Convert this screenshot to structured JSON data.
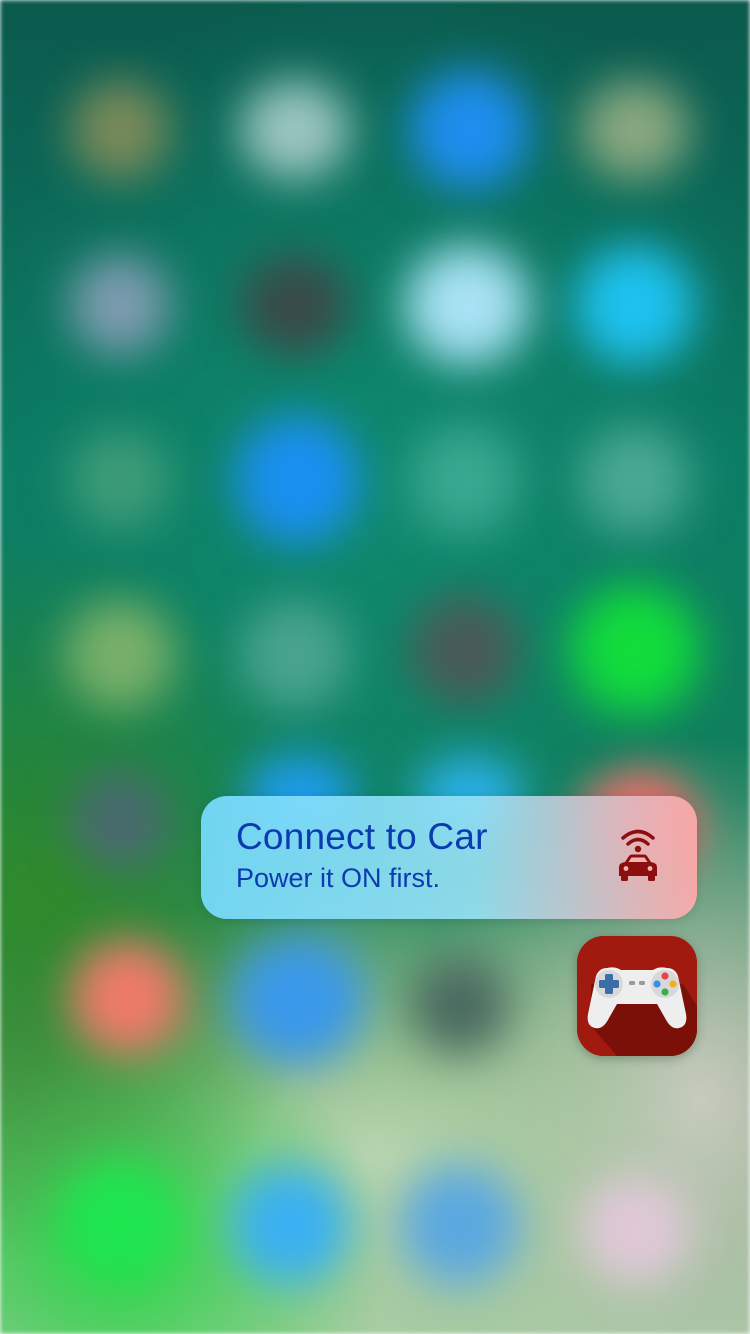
{
  "quick_action": {
    "title": "Connect to Car",
    "subtitle": "Power it ON first.",
    "icon": "car-wifi-icon",
    "icon_color": "#8c0f0f",
    "text_color": "#0b3bb0"
  },
  "app_icon": {
    "icon": "gamepad-icon",
    "background_color": "#a01a10"
  }
}
